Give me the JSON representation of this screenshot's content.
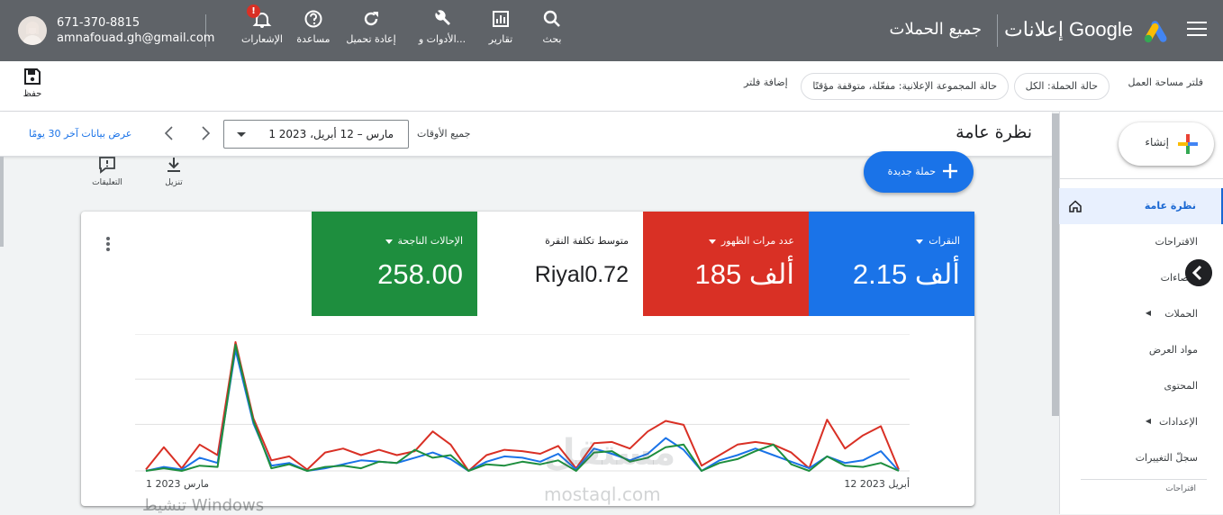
{
  "topbar": {
    "brand": "إعلانات Google",
    "account_title": "جميع الحملات",
    "tools": {
      "search": "بحث",
      "reports": "تقارير",
      "tools_settings": "الأدوات و...",
      "refresh": "إعادة تحميل",
      "help": "مساعدة",
      "notifications": "الإشعارات"
    },
    "notification_badge": "!",
    "user": {
      "phone": "671-370-8815",
      "email": "amnafouad.gh@gmail.com"
    }
  },
  "filterbar": {
    "workspace_filter": "فلتر مساحة العمل",
    "campaign_status_chip": "حالة الحملة: الكل",
    "adgroup_status_chip": "حالة المجموعة الإعلانية: مفعّلة، متوقفة مؤقتًا",
    "add_filter": "إضافة فلتر",
    "save_label": "حفظ"
  },
  "sidebar": {
    "create_label": "إنشاء",
    "items": [
      {
        "label": "نظرة عامة"
      },
      {
        "label": "الاقتراحات"
      },
      {
        "label": "إحصاءات"
      },
      {
        "label": "الحملات"
      },
      {
        "label": "مواد العرض"
      },
      {
        "label": "المحتوى"
      },
      {
        "label": "الإعدادات"
      },
      {
        "label": "سجلّ التغييرات"
      }
    ],
    "sub_heading": "اقتراحات"
  },
  "header": {
    "title": "نظرة عامة",
    "all_time": "جميع الأوقات",
    "date_range": "1 مارس – 12 أبريل، 2023",
    "show_last_30": "عرض بيانات آخر 30 يومًا"
  },
  "actions": {
    "new_campaign": "حملة جديدة",
    "download": "تنزيل",
    "comments": "التعليقات"
  },
  "metrics": [
    {
      "label": "النقرات",
      "value": "2.15 ألف",
      "color": "#1a73e8"
    },
    {
      "label": "عدد مرات الظهور",
      "value": "185 ألف",
      "color": "#d93025"
    },
    {
      "label": "متوسط تكلفة النقرة",
      "value": "Riyal0.72",
      "color": "#ffffff"
    },
    {
      "label": "الإحالات الناجحة",
      "value": "258.00",
      "color": "#1e8e3e"
    }
  ],
  "chart_data": {
    "type": "line",
    "x_start_label": "1 مارس 2023",
    "x_end_label": "12 أبريل 2023",
    "series": [
      {
        "color": "#d93025",
        "values": [
          0.01,
          0.18,
          0.02,
          0.2,
          0.12,
          0.98,
          0.4,
          0.08,
          0.11,
          0.01,
          0.14,
          0.17,
          0.12,
          0.16,
          0.12,
          0.15,
          0.3,
          0.2,
          0.0,
          0.12,
          0.16,
          0.15,
          0.13,
          0.19,
          0.02,
          0.21,
          0.22,
          0.17,
          0.3,
          0.38,
          0.35,
          0.04,
          0.12,
          0.2,
          0.22,
          0.2,
          0.14,
          0.02,
          0.39,
          0.17,
          0.27,
          0.34,
          0.01
        ]
      },
      {
        "color": "#1a73e8",
        "values": [
          0.0,
          0.03,
          0.01,
          0.1,
          0.06,
          0.92,
          0.36,
          0.04,
          0.06,
          0.0,
          0.02,
          0.05,
          0.08,
          0.07,
          0.06,
          0.1,
          0.14,
          0.09,
          0.0,
          0.07,
          0.11,
          0.1,
          0.07,
          0.13,
          0.01,
          0.17,
          0.13,
          0.08,
          0.13,
          0.25,
          0.16,
          0.0,
          0.08,
          0.12,
          0.17,
          0.12,
          0.07,
          0.02,
          0.11,
          0.06,
          0.08,
          0.15,
          0.0
        ]
      },
      {
        "color": "#1e8e3e",
        "values": [
          0.0,
          0.02,
          0.0,
          0.04,
          0.03,
          0.96,
          0.38,
          0.02,
          0.05,
          0.0,
          0.03,
          0.04,
          0.02,
          0.07,
          0.06,
          0.16,
          0.1,
          0.12,
          0.0,
          0.05,
          0.04,
          0.07,
          0.05,
          0.08,
          0.0,
          0.14,
          0.15,
          0.07,
          0.1,
          0.18,
          0.2,
          0.0,
          0.06,
          0.09,
          0.15,
          0.2,
          0.05,
          0.0,
          0.11,
          0.04,
          0.03,
          0.06,
          0.0
        ]
      }
    ]
  },
  "watermark": {
    "line1": "مستقل",
    "line2": "mostaql.com"
  },
  "os_overlay": "تنشيط Windows"
}
